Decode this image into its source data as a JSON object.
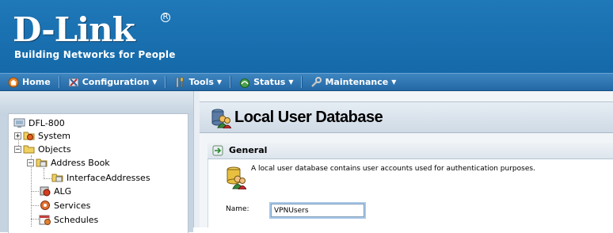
{
  "header": {
    "logo": "D-Link",
    "registered": "R",
    "tagline": "Building Networks for People"
  },
  "menu": [
    {
      "label": "Home",
      "icon": "home-icon",
      "has_caret": false
    },
    {
      "label": "Configuration",
      "icon": "configuration-icon",
      "has_caret": true
    },
    {
      "label": "Tools",
      "icon": "tools-icon",
      "has_caret": true
    },
    {
      "label": "Status",
      "icon": "status-icon",
      "has_caret": true
    },
    {
      "label": "Maintenance",
      "icon": "maintenance-icon",
      "has_caret": true
    }
  ],
  "tree": {
    "root": "DFL-800",
    "system": "System",
    "objects": "Objects",
    "address_book": "Address Book",
    "interface_addresses": "InterfaceAddresses",
    "alg": "ALG",
    "services": "Services",
    "schedules": "Schedules"
  },
  "page": {
    "title": "Local User Database",
    "section_title": "General",
    "description": "A local user database contains user accounts used for authentication purposes.",
    "name_label": "Name:",
    "name_value": "VPNUsers"
  },
  "colors": {
    "header_blue": "#1a6fae",
    "menubar_blue": "#2368a6"
  }
}
